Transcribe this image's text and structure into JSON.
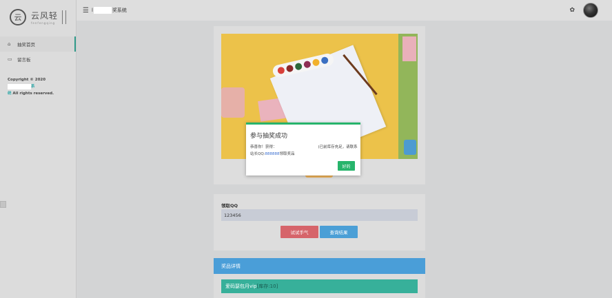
{
  "sidebar": {
    "logo_char": "云",
    "logo_text": "云风轻",
    "logo_sub": "fenfengqing",
    "items": [
      {
        "label": "抽奖首页",
        "icon": "home-icon"
      },
      {
        "label": "留言板",
        "icon": "monitor-icon"
      }
    ],
    "copyright_prefix": "Copyright © 2020",
    "copyright_suffix": "系",
    "copyright_line2_accent": "统",
    "copyright_line2": " All rights reserved."
  },
  "header": {
    "title_prefix": "l",
    "title_suffix": "奖系统",
    "menu_icon": "hamburger-menu-icon",
    "palette_icon": "palette-icon"
  },
  "card_main": {
    "qq_label": "领取QQ",
    "qq_value": "123456",
    "try_button": "试试手气",
    "query_button": "查询结果"
  },
  "prize": {
    "header": "奖品详情",
    "item_name": "爱码瑟包月vip",
    "item_stock": "[库存:10]"
  },
  "modal": {
    "title": "参与抽奖成功",
    "body_prefix": "恭喜你！获得：",
    "body_middle": "(已前库存充足，请联系",
    "body_line2_prefix": "站长QQ:",
    "body_link": "888888",
    "body_line2_suffix": "领取奖品",
    "ok_button": "好的"
  },
  "colors": {
    "accent_green": "#27b46b",
    "teal": "#37b09a",
    "blue": "#4a9ed8",
    "red_button": "#d6646a"
  }
}
